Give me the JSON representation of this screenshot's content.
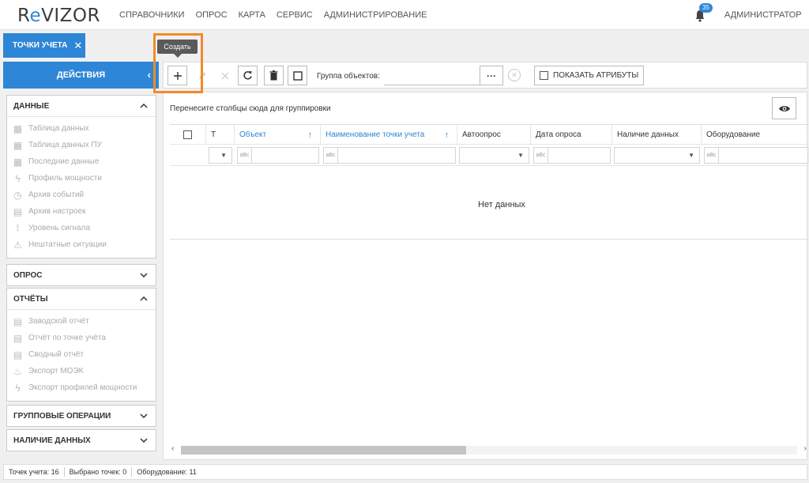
{
  "header": {
    "logo_first": "R",
    "logo_e": "e",
    "logo_rest": "VIZOR",
    "nav": [
      "СПРАВОЧНИКИ",
      "ОПРОС",
      "КАРТА",
      "СЕРВИС",
      "АДМИНИСТРИРОВАНИЕ"
    ],
    "notifications_count": "35",
    "user": "АДМИНИСТРАТОР"
  },
  "tab": {
    "label": "ТОЧКИ УЧЕТА",
    "close": "✕"
  },
  "actions": {
    "label": "ДЕЙСТВИЯ",
    "chevron": "‹"
  },
  "toolbar": {
    "tooltip": "Создать",
    "group_label": "Группа объектов:",
    "group_value": "",
    "dots_label": "···",
    "clear_label": "✕",
    "show_attributes": "ПОКАЗАТЬ АТРИБУТЫ",
    "icons": [
      "plus-icon",
      "edit-icon",
      "close-icon",
      "refresh-icon",
      "trash-icon",
      "square-icon"
    ]
  },
  "sidebar": {
    "sections": [
      {
        "title": "ДАННЫЕ",
        "chevron": "⌃",
        "items": [
          {
            "label": "Таблица данных",
            "icon": "▦"
          },
          {
            "label": "Таблица данных ПУ",
            "icon": "▦"
          },
          {
            "label": "Последние данные",
            "icon": "▦"
          },
          {
            "label": "Профиль мощности",
            "icon": "ϟ"
          },
          {
            "label": "Архив событий",
            "icon": "◷"
          },
          {
            "label": "Архив настроек",
            "icon": "▤"
          },
          {
            "label": "Уровень сигнала",
            "icon": "⟟"
          },
          {
            "label": "Нештатные ситуации",
            "icon": "⚠"
          }
        ]
      },
      {
        "title": "ОПРОС",
        "chevron": "⌄"
      },
      {
        "title": "ОТЧЁТЫ",
        "chevron": "⌃",
        "items": [
          {
            "label": "Заводской отчёт",
            "icon": "▤"
          },
          {
            "label": "Отчёт по точке учёта",
            "icon": "▤"
          },
          {
            "label": "Сводный отчёт",
            "icon": "▤"
          },
          {
            "label": "Экспорт МОЭК",
            "icon": "♨"
          },
          {
            "label": "Экспорт профилей мощности",
            "icon": "ϟ"
          }
        ]
      },
      {
        "title": "ГРУППОВЫЕ ОПЕРАЦИИ",
        "chevron": "⌄"
      },
      {
        "title": "НАЛИЧИЕ ДАННЫХ",
        "chevron": "⌄"
      }
    ]
  },
  "grid": {
    "group_hint": "Перенесите столбцы сюда для группировки",
    "columns": [
      {
        "label": "T"
      },
      {
        "label": "Объект",
        "sorted": true
      },
      {
        "label": "Наименование точки учета",
        "sorted": true
      },
      {
        "label": "Автоопрос"
      },
      {
        "label": "Дата опроса"
      },
      {
        "label": "Наличие данных"
      },
      {
        "label": "Оборудование"
      }
    ],
    "abc_label": "aBc",
    "no_data": "Нет данных"
  },
  "statusbar": {
    "points": "Точек учета: 16",
    "selected": "Выбрано точек: 0",
    "equipment": "Оборудование: 11"
  },
  "colors": {
    "accent": "#2e86d6",
    "highlight": "#f28a2a"
  }
}
